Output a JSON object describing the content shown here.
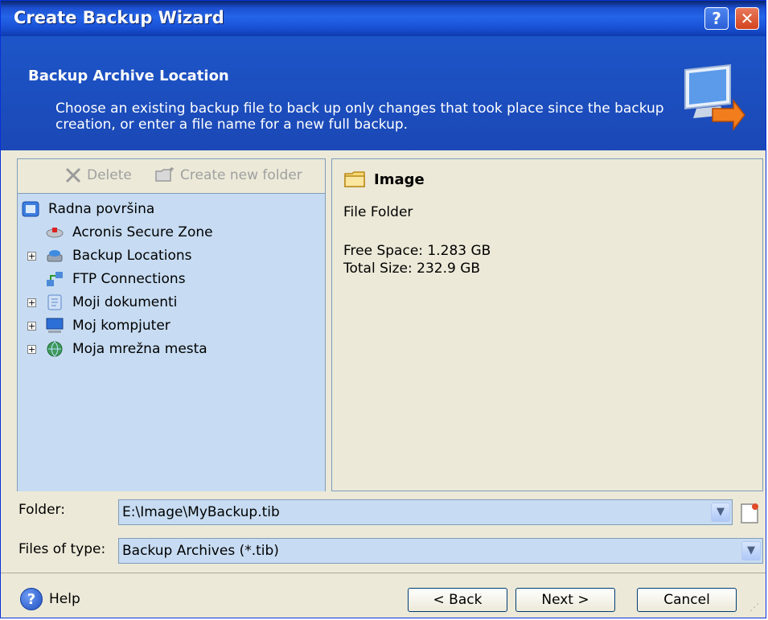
{
  "window": {
    "title": "Create Backup Wizard",
    "help_glyph": "?",
    "close_glyph": "✕"
  },
  "banner": {
    "title": "Backup Archive Location",
    "description": "Choose an existing backup file to back up only changes that took place since the backup creation, or enter a file name for a new full backup.",
    "icon": "monitor-arrow-icon"
  },
  "toolbar": {
    "delete_label": "Delete",
    "new_folder_label": "Create new folder"
  },
  "tree": {
    "items": [
      {
        "label": "Radna površina",
        "icon": "desktop-icon",
        "expandable": false
      },
      {
        "label": "Acronis Secure Zone",
        "icon": "secure-zone-icon",
        "expandable": false
      },
      {
        "label": "Backup Locations",
        "icon": "backup-locations-icon",
        "expandable": true
      },
      {
        "label": "FTP Connections",
        "icon": "ftp-icon",
        "expandable": false
      },
      {
        "label": "Moji dokumenti",
        "icon": "documents-icon",
        "expandable": true
      },
      {
        "label": "Moj kompjuter",
        "icon": "computer-icon",
        "expandable": true
      },
      {
        "label": "Moja mrežna mesta",
        "icon": "network-icon",
        "expandable": true
      }
    ]
  },
  "info": {
    "name": "Image",
    "type": "File Folder",
    "free_space": "Free Space: 1.283 GB",
    "total_size": "Total Size: 232.9 GB"
  },
  "fields": {
    "folder_label": "Folder:",
    "folder_value": "E:\\Image\\MyBackup.tib",
    "type_label": "Files of type:",
    "type_value": "Backup Archives (*.tib)"
  },
  "buttons": {
    "help": "Help",
    "back": "< Back",
    "next": "Next >",
    "cancel": "Cancel"
  },
  "colors": {
    "titlebar": "#1c4fd0",
    "banner": "#1d55c8",
    "pane_bg": "#c7dcf2",
    "dialog_bg": "#ece9d8"
  }
}
